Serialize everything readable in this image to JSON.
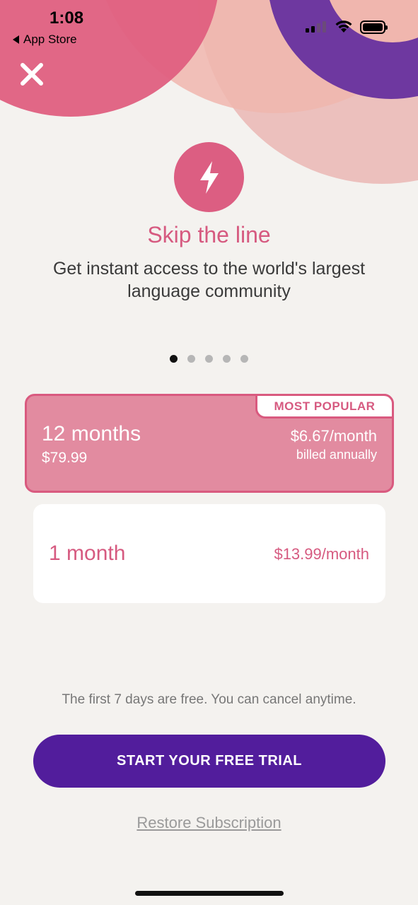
{
  "status_bar": {
    "time": "1:08",
    "back_label": "App Store"
  },
  "icons": {
    "close": "close-icon",
    "hero": "lightning-bolt-icon",
    "signal": "cellular-signal-icon",
    "wifi": "wifi-icon",
    "battery": "battery-icon"
  },
  "hero": {
    "title": "Skip the line",
    "subtitle": "Get instant access to the world's largest language community"
  },
  "pagination": {
    "total": 5,
    "active_index": 0
  },
  "plans": {
    "annual": {
      "badge": "MOST POPULAR",
      "duration": "12 months",
      "total_price": "$79.99",
      "monthly_price": "$6.67/month",
      "billing_note": "billed annually",
      "selected": true
    },
    "monthly": {
      "duration": "1 month",
      "monthly_price": "$13.99/month",
      "selected": false
    }
  },
  "trial_note": "The first 7 days are free. You can cancel anytime.",
  "cta_label": "START YOUR FREE TRIAL",
  "restore_label": "Restore Subscription",
  "colors": {
    "accent_pink": "#d65a80",
    "selected_plan_bg": "#e28ba0",
    "cta_purple": "#521d9c",
    "background": "#f4f2ef"
  }
}
